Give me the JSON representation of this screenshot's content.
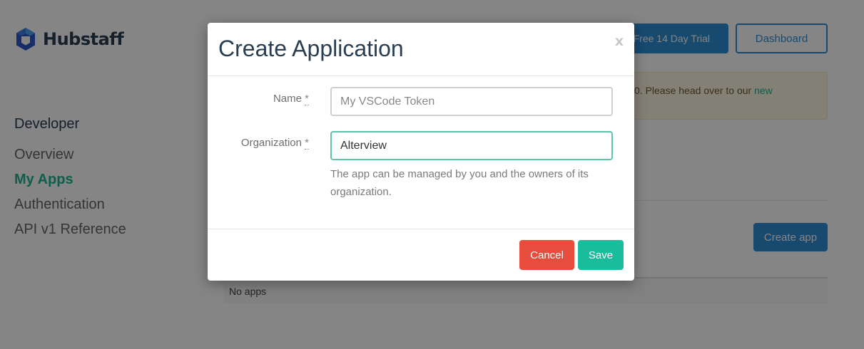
{
  "brand": {
    "name": "Hubstaff",
    "color": "#2a3e52"
  },
  "header": {
    "trial_button": "Free 14 Day Trial",
    "dashboard_button": "Dashboard"
  },
  "notice": {
    "text": "0. Please head over to our ",
    "link": "new"
  },
  "sidebar": {
    "heading": "Developer",
    "items": [
      {
        "label": "Overview",
        "active": false
      },
      {
        "label": "My Apps",
        "active": true
      },
      {
        "label": "Authentication",
        "active": false
      },
      {
        "label": "API v1 Reference",
        "active": false
      }
    ]
  },
  "main": {
    "create_app_button": "Create app",
    "empty_text": "No apps"
  },
  "modal": {
    "title": "Create Application",
    "close_icon": "x",
    "fields": {
      "name": {
        "label": "Name",
        "required_mark": "*",
        "placeholder": "My VSCode Token",
        "value": ""
      },
      "organization": {
        "label": "Organization",
        "required_mark": "*",
        "value": "Alterview",
        "help": "The app can be managed by you and the owners of its organization."
      }
    },
    "cancel_button": "Cancel",
    "save_button": "Save"
  },
  "colors": {
    "primary": "#2f8fd6",
    "accent": "#1db590",
    "danger": "#e74c3c",
    "save": "#1abc9c"
  }
}
